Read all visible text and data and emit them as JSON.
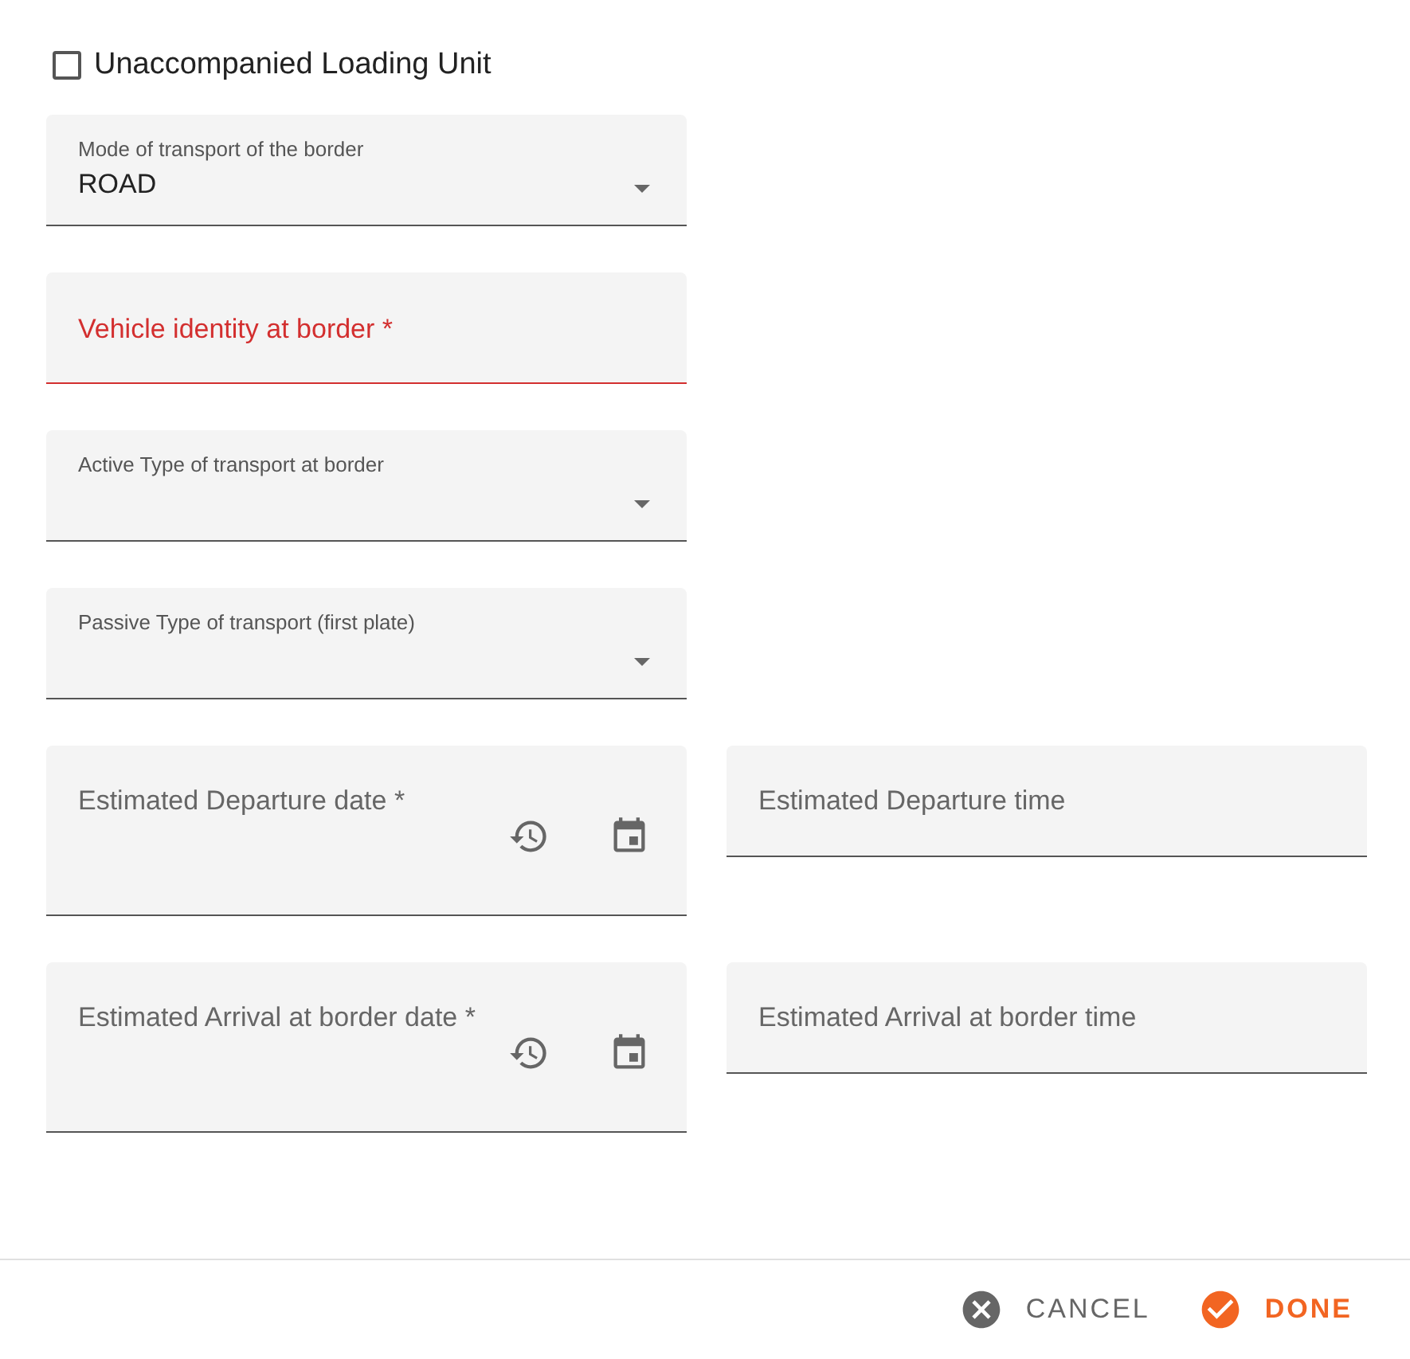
{
  "checkbox": {
    "label": "Unaccompanied Loading Unit",
    "checked": false
  },
  "fields": [
    {
      "kind": "select",
      "label": "Mode of transport of the border",
      "value": "ROAD",
      "error": false
    },
    {
      "kind": "text",
      "label": "Vehicle identity at border *",
      "error": true
    },
    {
      "kind": "select",
      "label": "Active Type of transport at border",
      "error": false
    },
    {
      "kind": "select",
      "label": "Passive Type of transport (first plate)",
      "error": false
    }
  ],
  "date_rows": [
    {
      "date_label": "Estimated Departure date *",
      "time_label": "Estimated Departure time"
    },
    {
      "date_label": "Estimated Arrival at border date *",
      "time_label": "Estimated Arrival at border time"
    }
  ],
  "actions": [
    {
      "kind": "cancel",
      "label": "CANCEL"
    },
    {
      "kind": "done",
      "label": "DONE"
    }
  ]
}
